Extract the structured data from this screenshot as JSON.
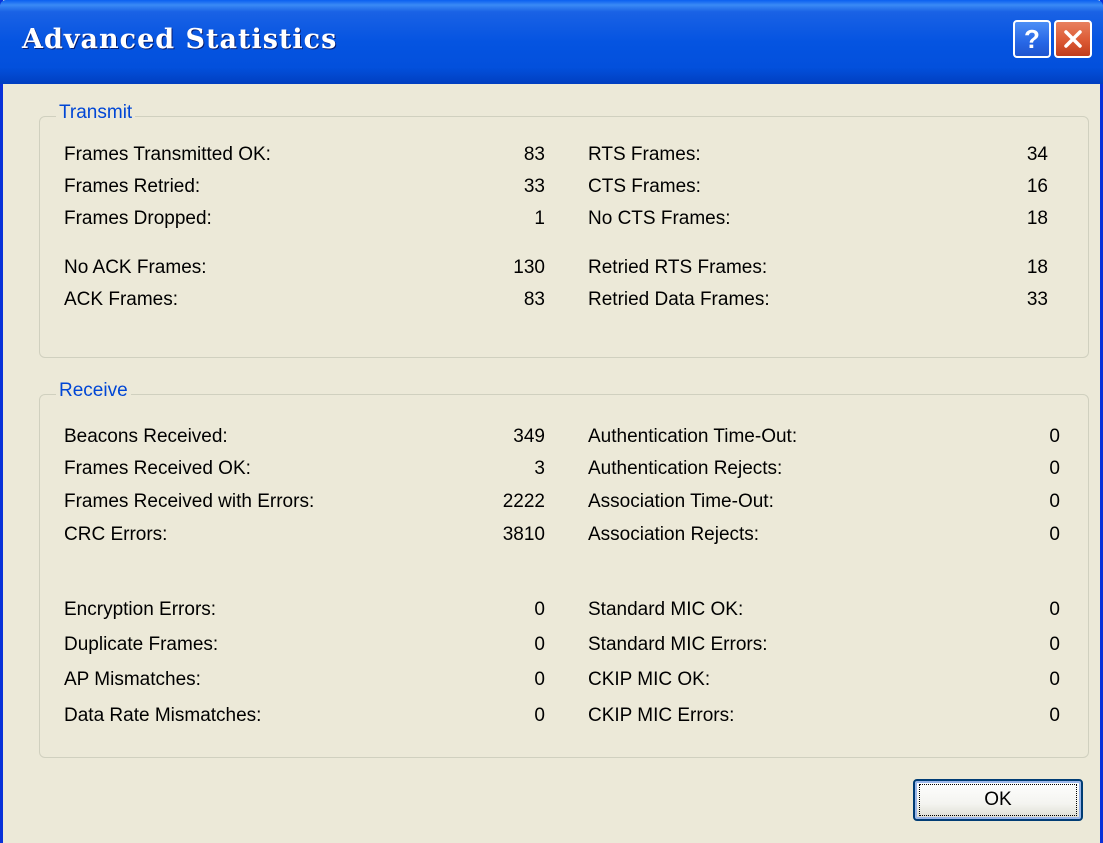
{
  "window": {
    "title": "Advanced Statistics",
    "colors": {
      "titlebar": "#0554e1",
      "legend_text": "#0046d5",
      "face": "#ece9d8"
    }
  },
  "icons": {
    "help": "help-icon",
    "close": "close-icon"
  },
  "transmit": {
    "title": "Transmit",
    "left": [
      {
        "label": "Frames Transmitted OK:",
        "value": "83"
      },
      {
        "label": "Frames Retried:",
        "value": "33"
      },
      {
        "label": "Frames Dropped:",
        "value": "1"
      },
      {
        "label": "No ACK Frames:",
        "value": "130"
      },
      {
        "label": "ACK Frames:",
        "value": "83"
      }
    ],
    "right": [
      {
        "label": "RTS Frames:",
        "value": "34"
      },
      {
        "label": "CTS Frames:",
        "value": "16"
      },
      {
        "label": "No CTS Frames:",
        "value": "18"
      },
      {
        "label": "Retried RTS Frames:",
        "value": "18"
      },
      {
        "label": "Retried Data Frames:",
        "value": "33"
      }
    ]
  },
  "receive": {
    "title": "Receive",
    "left": [
      {
        "label": "Beacons Received:",
        "value": "349"
      },
      {
        "label": "Frames Received OK:",
        "value": "3"
      },
      {
        "label": "Frames Received with Errors:",
        "value": "2222"
      },
      {
        "label": "CRC Errors:",
        "value": "3810"
      },
      {
        "label": "Encryption Errors:",
        "value": "0"
      },
      {
        "label": "Duplicate Frames:",
        "value": "0"
      },
      {
        "label": "AP Mismatches:",
        "value": "0"
      },
      {
        "label": "Data Rate Mismatches:",
        "value": "0"
      }
    ],
    "right": [
      {
        "label": "Authentication Time-Out:",
        "value": "0"
      },
      {
        "label": "Authentication Rejects:",
        "value": "0"
      },
      {
        "label": "Association Time-Out:",
        "value": "0"
      },
      {
        "label": "Association Rejects:",
        "value": "0"
      },
      {
        "label": "Standard MIC OK:",
        "value": "0"
      },
      {
        "label": "Standard MIC Errors:",
        "value": "0"
      },
      {
        "label": "CKIP MIC OK:",
        "value": "0"
      },
      {
        "label": "CKIP MIC Errors:",
        "value": "0"
      }
    ]
  },
  "buttons": {
    "ok": "OK"
  }
}
